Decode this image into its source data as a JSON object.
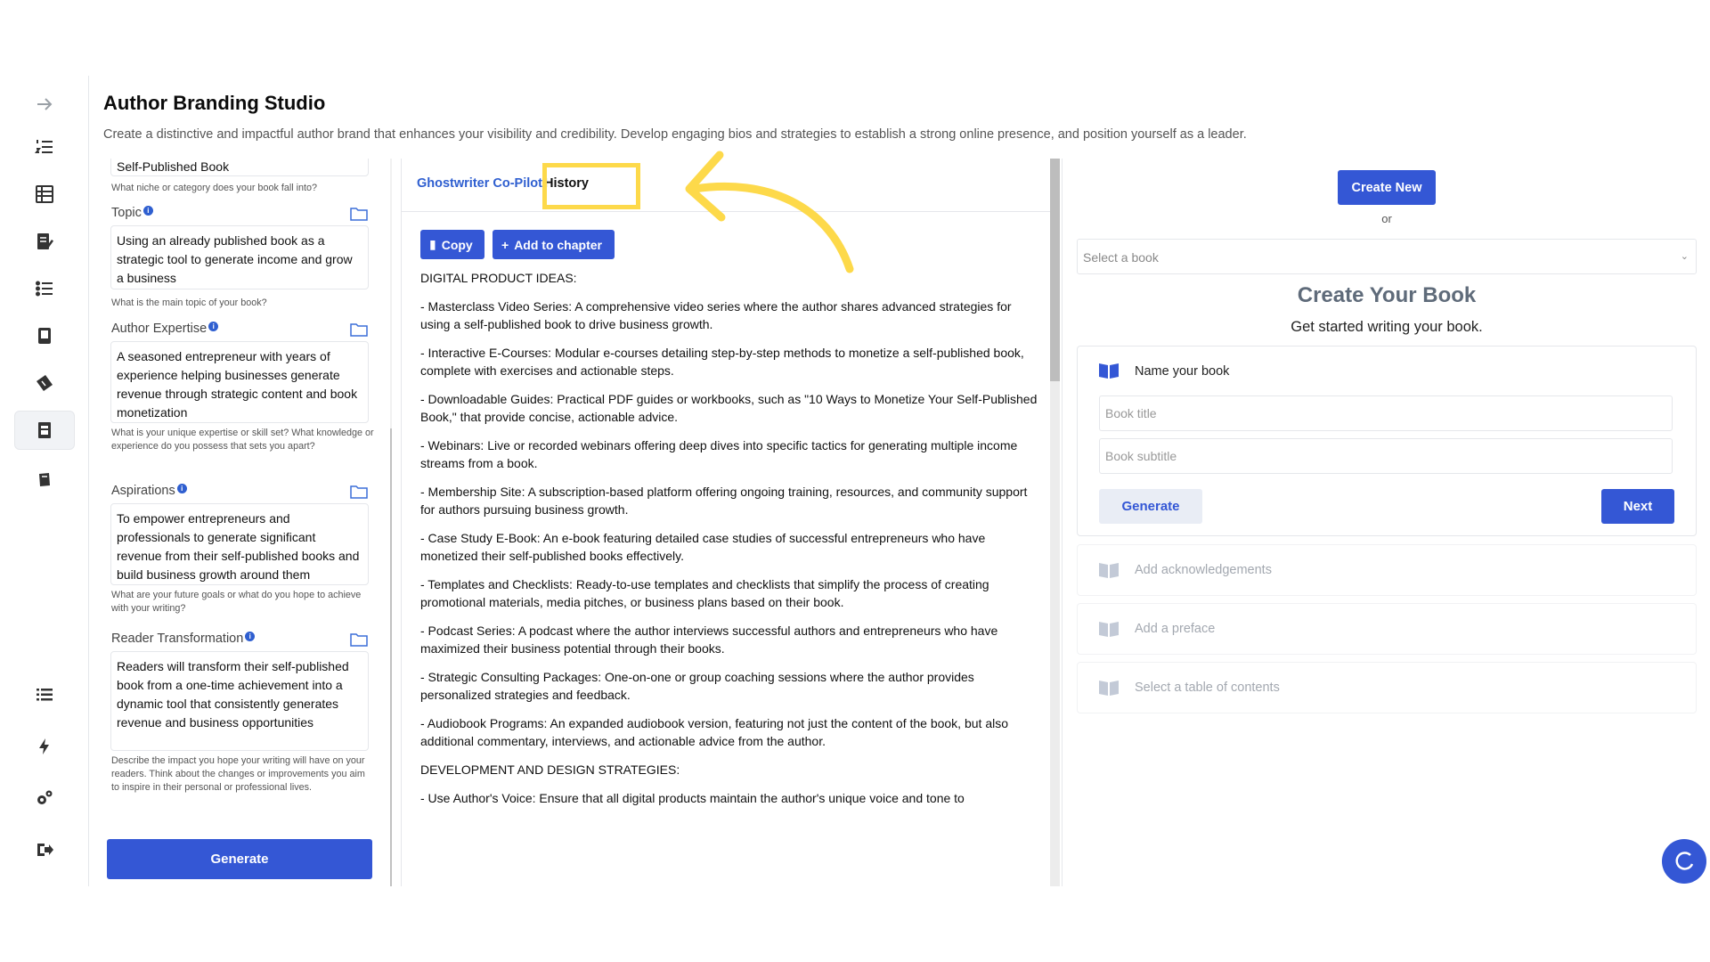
{
  "header": {
    "title": "Author Branding Studio",
    "subtitle": "Create a distinctive and impactful author brand that enhances your visibility and credibility. Develop engaging bios and strategies to establish a strong online presence, and position yourself as a leader."
  },
  "rail": {
    "icons": [
      "arrow-right-icon",
      "numbered-list-icon",
      "table-icon",
      "edit-document-icon",
      "checklist-icon",
      "book-device-icon",
      "ticket-icon",
      "document-stack-icon",
      "book-icon",
      "list-icon",
      "lightning-icon",
      "settings-gear-icon",
      "logout-icon"
    ]
  },
  "form": {
    "niche_value": "Self-Published Book",
    "niche_help": "What niche or category does your book fall into?",
    "topic_label": "Topic",
    "topic_value": "Using an already published book as a strategic tool to generate income and grow a business",
    "topic_help": "What is the main topic of your book?",
    "expertise_label": "Author Expertise",
    "expertise_value": "A seasoned entrepreneur with years of experience helping businesses generate revenue through strategic content and book monetization",
    "expertise_help": "What is your unique expertise or skill set? What knowledge or experience do you possess that sets you apart?",
    "aspirations_label": "Aspirations",
    "aspirations_value": "To empower entrepreneurs and professionals to generate significant revenue from their self-published books and build business growth around them",
    "aspirations_help": "What are your future goals or what do you hope to achieve with your writing?",
    "transformation_label": "Reader Transformation",
    "transformation_value": "Readers will transform their self-published book from a one-time achievement into a dynamic tool that consistently generates revenue and business opportunities",
    "transformation_help": "Describe the impact you hope your writing will have on your readers. Think about the changes or improvements you aim to inspire in their personal or professional lives.",
    "generate_label": "Generate"
  },
  "middle": {
    "tab_copilot": "Ghostwriter Co-Pilot",
    "tab_history": "History",
    "copy_label": "Copy",
    "add_label": "Add to chapter",
    "paragraphs": [
      "DIGITAL PRODUCT IDEAS:",
      "- Masterclass Video Series: A comprehensive video series where the author shares advanced strategies for using a self-published book to drive business growth.",
      "- Interactive E-Courses: Modular e-courses detailing step-by-step methods to monetize a self-published book, complete with exercises and actionable steps.",
      "- Downloadable Guides: Practical PDF guides or workbooks, such as \"10 Ways to Monetize Your Self-Published Book,\" that provide concise, actionable advice.",
      "- Webinars: Live or recorded webinars offering deep dives into specific tactics for generating multiple income streams from a book.",
      "- Membership Site: A subscription-based platform offering ongoing training, resources, and community support for authors pursuing business growth.",
      "- Case Study E-Book: An e-book featuring detailed case studies of successful entrepreneurs who have monetized their self-published books effectively.",
      "- Templates and Checklists: Ready-to-use templates and checklists that simplify the process of creating promotional materials, media pitches, or business plans based on their book.",
      "- Podcast Series: A podcast where the author interviews successful authors and entrepreneurs who have maximized their business potential through their books.",
      "- Strategic Consulting Packages: One-on-one or group coaching sessions where the author provides personalized strategies and feedback.",
      "- Audiobook Programs: An expanded audiobook version, featuring not just the content of the book, but also additional commentary, interviews, and actionable advice from the author.",
      "DEVELOPMENT AND DESIGN STRATEGIES:",
      "- Use Author's Voice: Ensure that all digital products maintain the author's unique voice and tone to"
    ]
  },
  "right": {
    "create_new": "Create New",
    "or": "or",
    "select_placeholder": "Select a book",
    "title": "Create Your Book",
    "subtitle": "Get started writing your book.",
    "name_label": "Name your book",
    "book_title_placeholder": "Book title",
    "book_subtitle_placeholder": "Book subtitle",
    "generate": "Generate",
    "next": "Next",
    "steps": [
      "Add acknowledgements",
      "Add a preface",
      "Select a table of contents"
    ]
  },
  "colors": {
    "accent": "#3457d5",
    "highlight": "#fdd94a"
  }
}
